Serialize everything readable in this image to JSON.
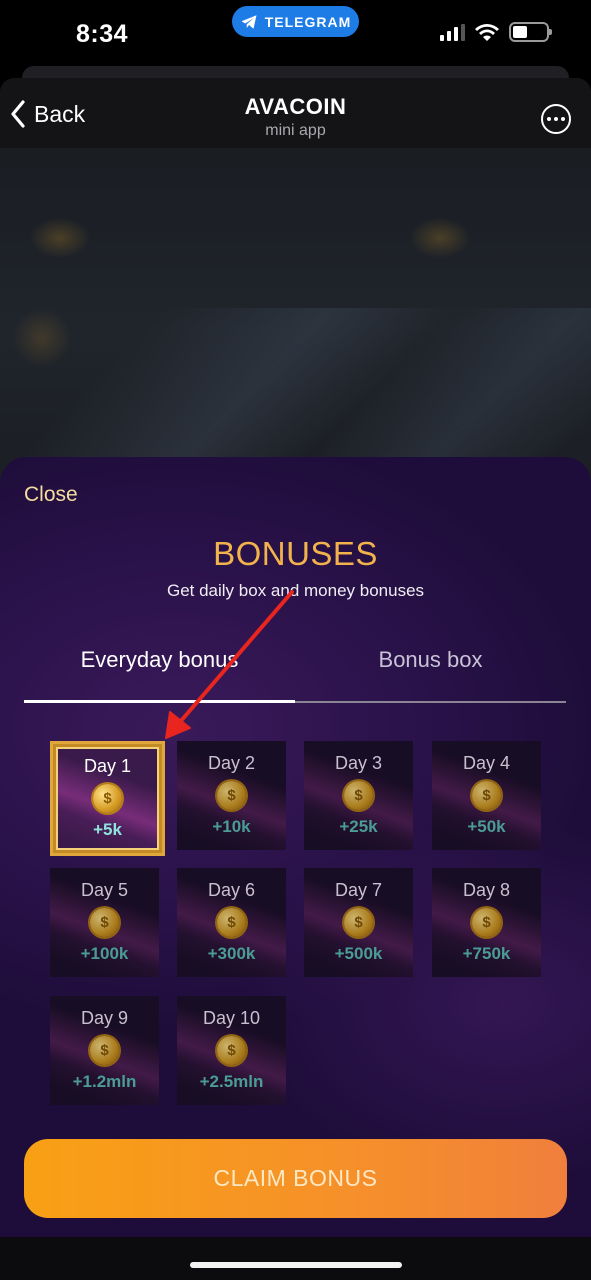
{
  "status_bar": {
    "time": "8:34",
    "pill_label": "TELEGRAM",
    "icons": [
      "cellular-signal-icon",
      "wifi-icon",
      "battery-icon"
    ]
  },
  "nav": {
    "back_label": "Back",
    "title": "AVACOIN",
    "subtitle": "mini app",
    "more_icon": "more-icon"
  },
  "sheet": {
    "close_label": "Close",
    "title": "BONUSES",
    "subtitle": "Get daily box and money bonuses",
    "tabs": [
      {
        "label": "Everyday bonus",
        "active": true
      },
      {
        "label": "Bonus box",
        "active": false
      }
    ],
    "days": [
      {
        "label": "Day 1",
        "amount": "+5k",
        "active": true
      },
      {
        "label": "Day 2",
        "amount": "+10k",
        "active": false
      },
      {
        "label": "Day 3",
        "amount": "+25k",
        "active": false
      },
      {
        "label": "Day 4",
        "amount": "+50k",
        "active": false
      },
      {
        "label": "Day 5",
        "amount": "+100k",
        "active": false
      },
      {
        "label": "Day 6",
        "amount": "+300k",
        "active": false
      },
      {
        "label": "Day 7",
        "amount": "+500k",
        "active": false
      },
      {
        "label": "Day 8",
        "amount": "+750k",
        "active": false
      },
      {
        "label": "Day 9",
        "amount": "+1.2mln",
        "active": false
      },
      {
        "label": "Day 10",
        "amount": "+2.5mln",
        "active": false
      }
    ],
    "claim_label": "CLAIM BONUS"
  },
  "colors": {
    "accent_gold": "#f2b24c",
    "claim_orange": "#f8a014",
    "amount_teal": "#4a9c95",
    "annotation_red": "#e8251e",
    "telegram_blue": "#1e7ce6"
  }
}
